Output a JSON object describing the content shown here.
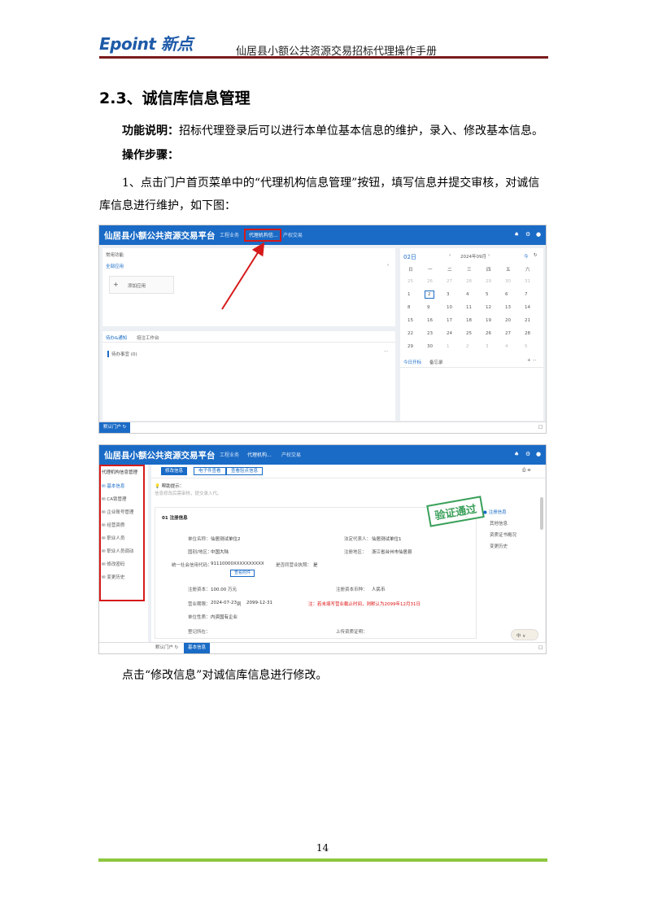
{
  "header": {
    "logo": "Epoint 新点",
    "doc_title": "仙居县小额公共资源交易招标代理操作手册"
  },
  "section": {
    "heading": "2.3、诚信库信息管理",
    "func_label": "功能说明：",
    "func_text": "招标代理登录后可以进行本单位基本信息的维护，录入、修改基本信息。",
    "steps_label": "操作步骤：",
    "step1": "1、点击门户首页菜单中的“代理机构信息管理”按钮，填写信息并提交审核，对诚信库信息进行维护，如下图：",
    "step2": "点击“修改信息”对诚信库信息进行修改。"
  },
  "screenshot1": {
    "platform_title": "仙居县小额公共资源交易平台",
    "nav": [
      "工程业务",
      "代理机构信...",
      "产权交易"
    ],
    "common_functions": "常用功能",
    "all_apps": "全部应用",
    "add_app": "添加应用",
    "todo_tab": "待办&通知",
    "workbench_tab": "培注工作台",
    "todo_item": "待办事宜",
    "todo_count": "(0)",
    "today_tab": "今日开标",
    "memo_tab": "备忘录",
    "calendar": {
      "day_label": "02日",
      "month_label": "2024年09月",
      "today_link": "今",
      "weekdays": [
        "日",
        "一",
        "二",
        "三",
        "四",
        "五",
        "六"
      ],
      "weeks": [
        [
          "25",
          "26",
          "27",
          "28",
          "29",
          "30",
          "31"
        ],
        [
          "1",
          "2",
          "3",
          "4",
          "5",
          "6",
          "7"
        ],
        [
          "8",
          "9",
          "10",
          "11",
          "12",
          "13",
          "14"
        ],
        [
          "15",
          "16",
          "17",
          "18",
          "19",
          "20",
          "21"
        ],
        [
          "22",
          "23",
          "24",
          "25",
          "26",
          "27",
          "28"
        ],
        [
          "29",
          "30",
          "1",
          "2",
          "3",
          "4",
          "5"
        ]
      ],
      "selected": "2"
    },
    "bottom_tab": "默认门户"
  },
  "screenshot2": {
    "platform_title": "仙居县小额公共资源交易平台",
    "nav": [
      "工程业务",
      "代理机构...",
      "产权交易"
    ],
    "sidebar_title": "代理机构信息管理",
    "sidebar_items": [
      "基本信息",
      "CA锁管理",
      "企业账号管理",
      "经营资质",
      "职业人员",
      "职业人员调动",
      "修改密码",
      "变更历史"
    ],
    "top_buttons": [
      "修改信息",
      "电子件查看",
      "查看验点信息"
    ],
    "help_title": "帮助提示：",
    "help_text": "信息修改后需审核，提交录入代。",
    "section_title": "01  注册信息",
    "stamp": "验证通过",
    "fields": {
      "unit_name_label": "单位名称：",
      "unit_name": "仙居测试单位2",
      "legal_rep_label": "法定代表人：",
      "legal_rep": "仙居测试单位1",
      "country_label": "国别/地区：",
      "country": "中国大陆",
      "reg_addr_label": "注册地区：",
      "reg_addr": "浙江省台州市仙居县",
      "credit_code_label": "统一社会信用代码：",
      "credit_code": "91110000XXXXXXXXXX",
      "same_label": "是否同营业执照：",
      "same": "是",
      "view_btn": "查看附件",
      "capital_label": "注册资本：",
      "capital": "100.00 万元",
      "capital_currency_label": "注册资本币种：",
      "capital_currency": "人民币",
      "period_label": "营业期限：",
      "period_from": "2024-07-23",
      "period_to_word": "到",
      "period_to": "2099-12-31",
      "period_note": "注：若未填写营业截止时间，则默认为2099年12月31日",
      "unit_type_label": "单位性质：",
      "unit_type": "内资国有企业",
      "office_label": "登记所在：",
      "office": "",
      "upload_label": "上传资质证明：",
      "upload": ""
    },
    "right_nav": [
      "注册信息",
      "其他信息",
      "资质证书概况",
      "变更历史"
    ],
    "bottom_tabs": [
      "默认门户",
      "基本信息"
    ]
  },
  "footer": {
    "page_number": "14"
  }
}
